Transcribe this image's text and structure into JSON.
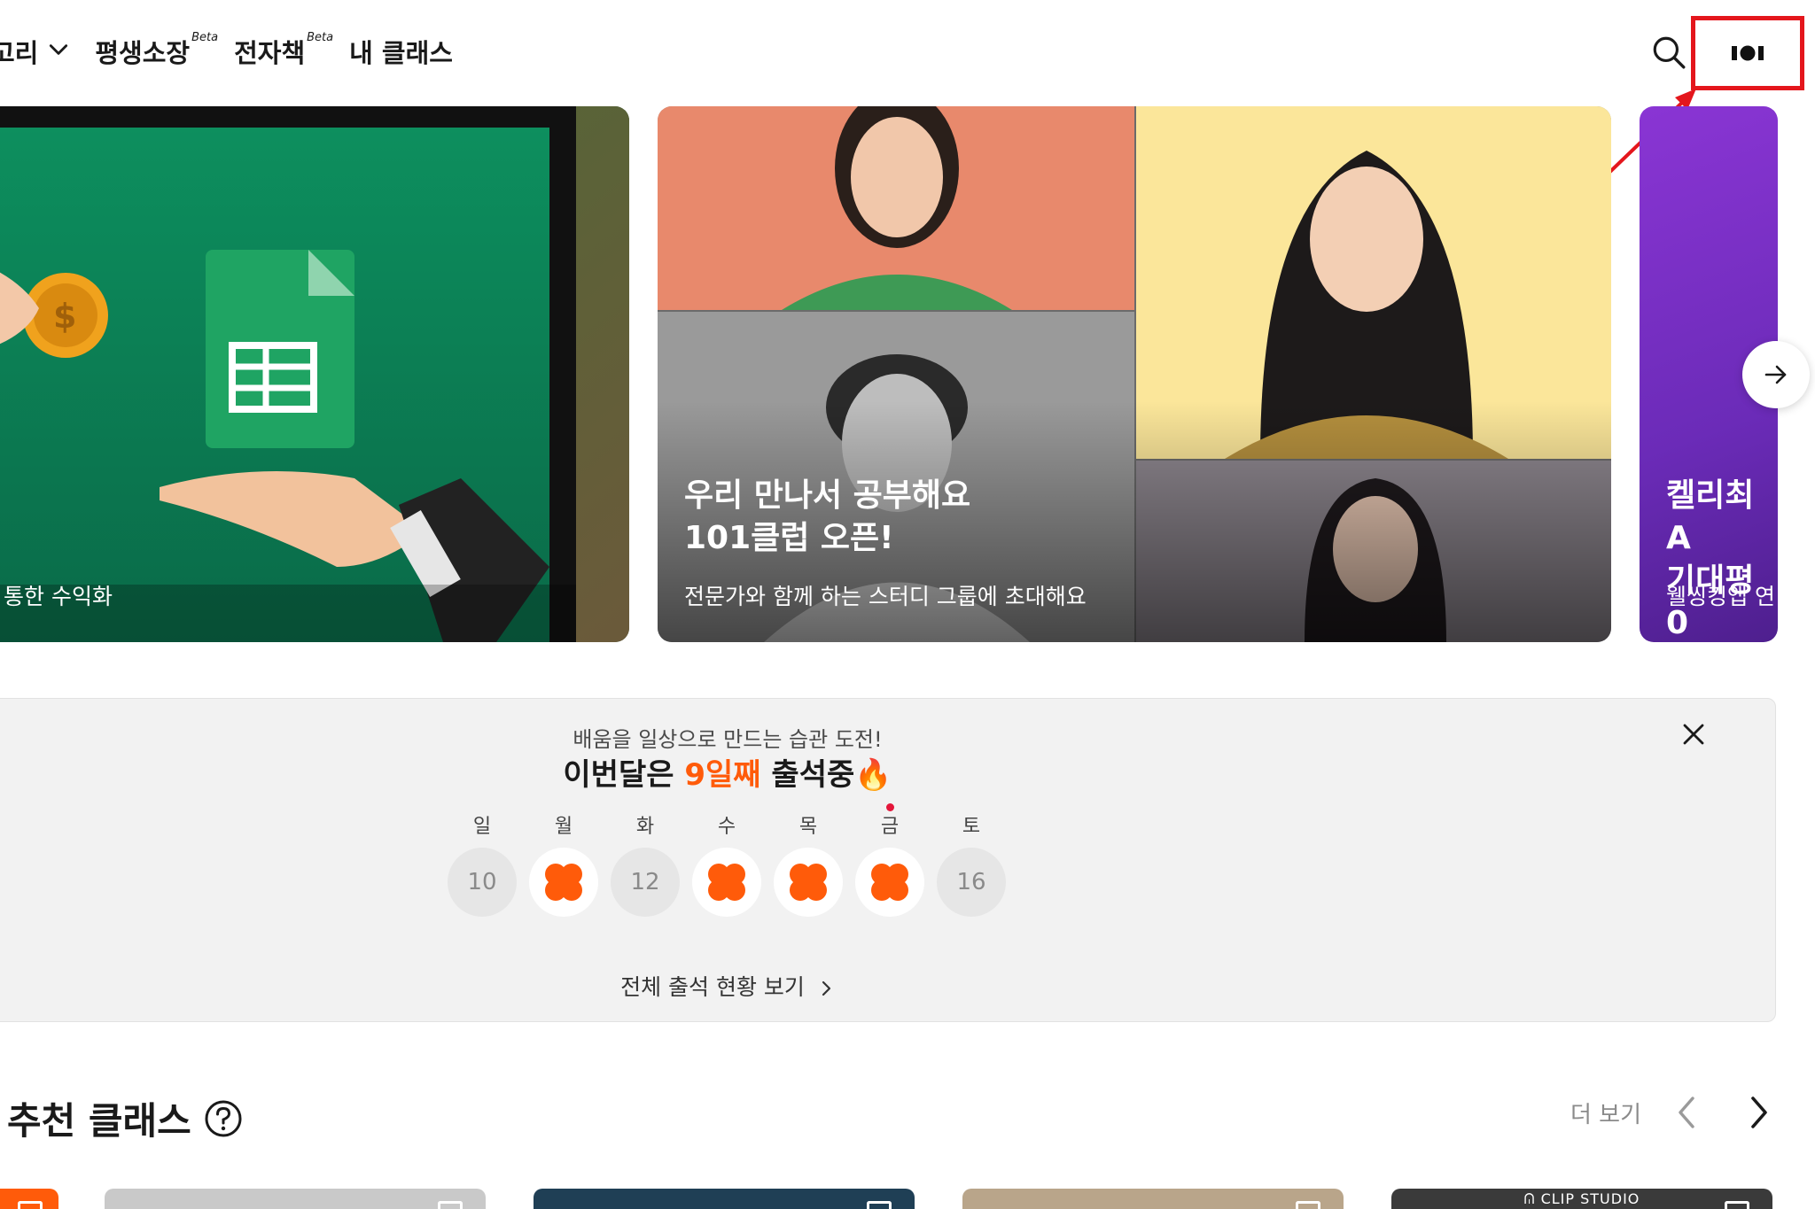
{
  "nav": {
    "category_label": "고리",
    "lifetime_label": "평생소장",
    "lifetime_badge": "Beta",
    "ebook_label": "전자책",
    "ebook_badge": "Beta",
    "my_class_label": "내 클래스"
  },
  "header": {
    "search_icon": "search-icon",
    "logo_text": "IOI"
  },
  "colors": {
    "accent": "#ff5b0a",
    "annotation": "#e4161c",
    "dot": "#e4163a"
  },
  "banners": [
    {
      "subtitle": "통한 수익화"
    },
    {
      "title": "우리 만나서 공부해요\n101클럽 오픈!",
      "subtitle": "전문가와 함께 하는 스터디 그룹에 초대해요"
    },
    {
      "title": "켈리최 A\n기대평 0",
      "subtitle": "웰씽킹앱 연"
    }
  ],
  "attendance": {
    "subtitle": "배움을 일상으로 만드는 습관 도전!",
    "title_prefix": "이번달은 ",
    "title_highlight": "9일째",
    "title_suffix": " 출석중",
    "title_emoji": "🔥",
    "link_label": "전체 출석 현황 보기",
    "days": [
      {
        "label": "일",
        "date": "10",
        "attended": false
      },
      {
        "label": "월",
        "date": "",
        "attended": true
      },
      {
        "label": "화",
        "date": "12",
        "attended": false
      },
      {
        "label": "수",
        "date": "",
        "attended": true
      },
      {
        "label": "목",
        "date": "",
        "attended": true
      },
      {
        "label": "금",
        "date": "",
        "attended": true,
        "today": true
      },
      {
        "label": "토",
        "date": "16",
        "attended": false
      }
    ]
  },
  "recommended": {
    "title": "추천 클래스",
    "more_label": "더 보기"
  },
  "cards": [
    {
      "label": ""
    },
    {
      "label": ""
    },
    {
      "label": ""
    },
    {
      "label": ""
    },
    {
      "label": "ᕬ CLIP STUDIO"
    }
  ]
}
